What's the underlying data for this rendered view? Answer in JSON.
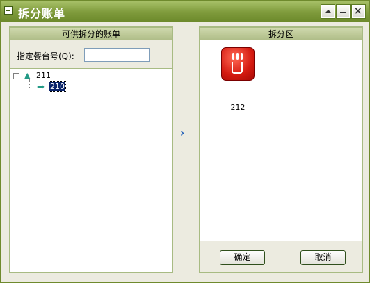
{
  "window": {
    "title": "拆分账单"
  },
  "left_panel": {
    "header": "可供拆分的账单",
    "table_label": "指定餐台号(Q):",
    "table_input_value": "",
    "tree": {
      "root": {
        "label": "211"
      },
      "child": {
        "label": "210"
      }
    }
  },
  "transfer": {
    "arrow": "›"
  },
  "right_panel": {
    "header": "拆分区",
    "tiles": [
      {
        "label": "212",
        "icon": "coffee-cup-icon"
      }
    ],
    "ok_label": "确定",
    "cancel_label": "取消"
  },
  "colors": {
    "titlebar": "#7f9b3c",
    "panel_header": "#c3cfa0",
    "panel_border": "#a8bb83",
    "tile_red": "#d41a10",
    "selection": "#0a246a"
  }
}
